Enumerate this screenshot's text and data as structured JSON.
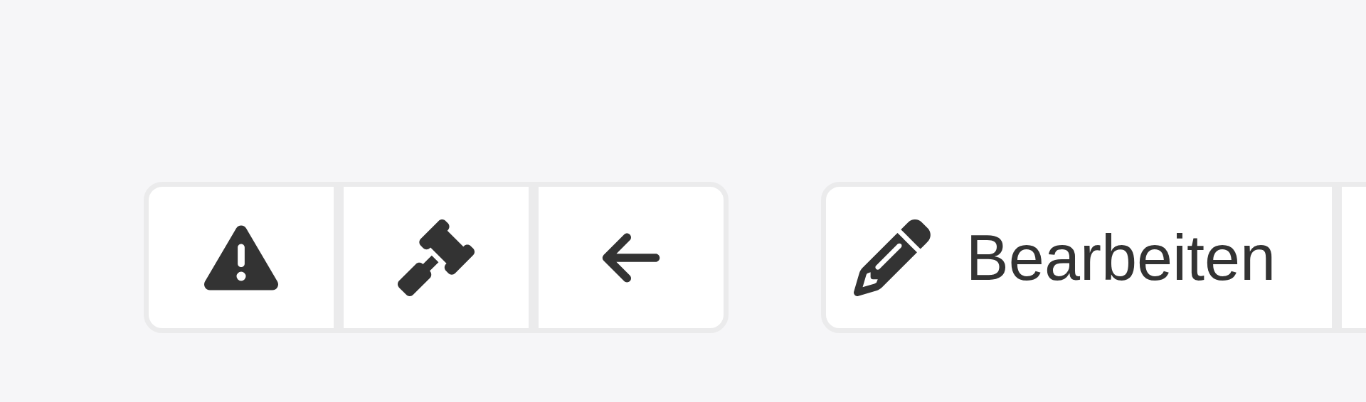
{
  "groups": [
    {
      "buttons": [
        {
          "kind": "warning"
        },
        {
          "kind": "gavel"
        },
        {
          "kind": "back"
        }
      ]
    },
    {
      "buttons": [
        {
          "kind": "edit",
          "label": "Bearbeiten"
        },
        {
          "kind": "partial"
        }
      ]
    }
  ]
}
